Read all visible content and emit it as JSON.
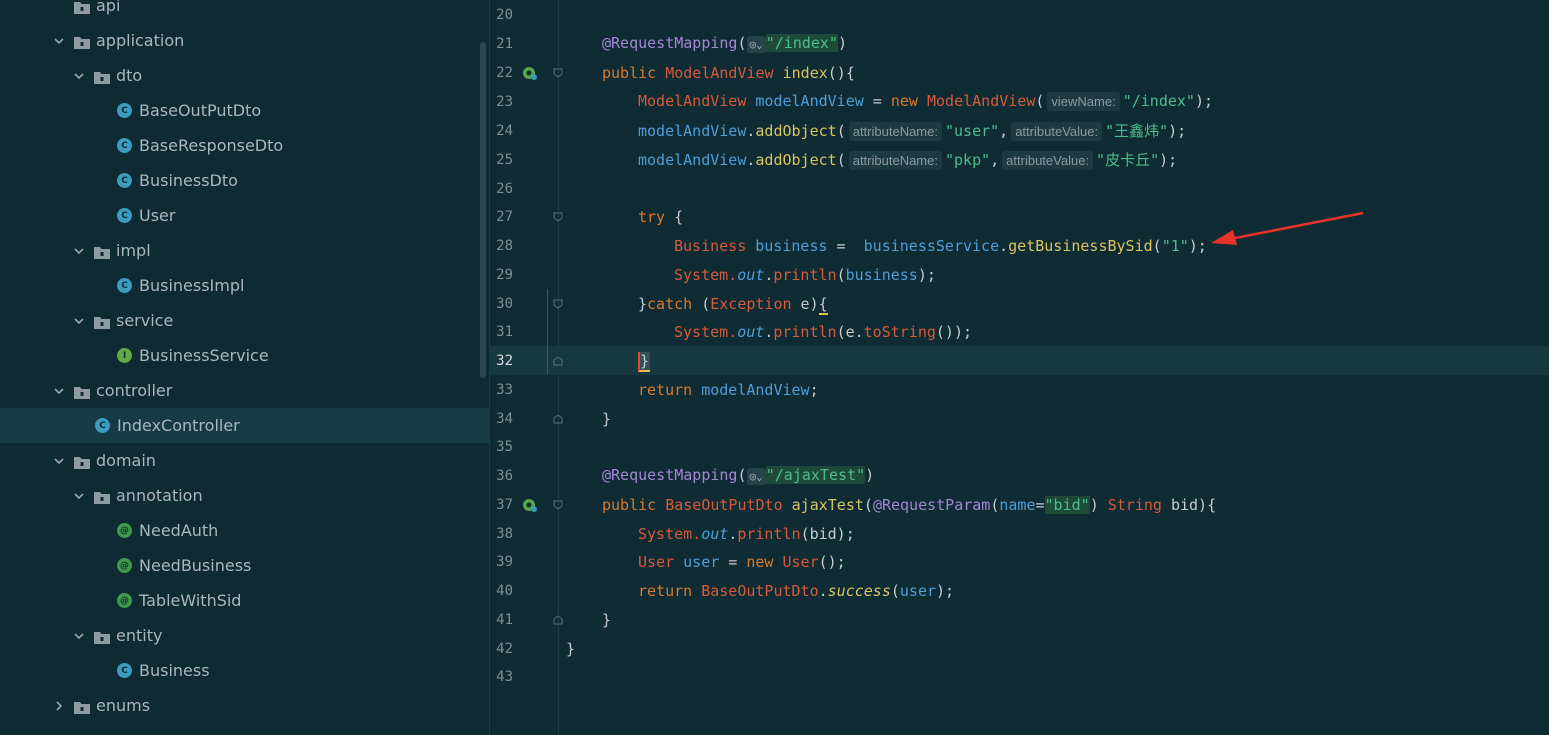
{
  "tree": {
    "items": [
      {
        "label": "api",
        "kind": "folder",
        "indent": 0,
        "expanded": false,
        "chevron": "none"
      },
      {
        "label": "application",
        "kind": "folder",
        "indent": 0,
        "expanded": true,
        "chevron": "down"
      },
      {
        "label": "dto",
        "kind": "folder",
        "indent": 1,
        "expanded": true,
        "chevron": "down"
      },
      {
        "label": "BaseOutPutDto",
        "kind": "class",
        "indent": 2
      },
      {
        "label": "BaseResponseDto",
        "kind": "class",
        "indent": 2
      },
      {
        "label": "BusinessDto",
        "kind": "class",
        "indent": 2
      },
      {
        "label": "User",
        "kind": "class",
        "indent": 2
      },
      {
        "label": "impl",
        "kind": "folder",
        "indent": 1,
        "expanded": true,
        "chevron": "down"
      },
      {
        "label": "BusinessImpl",
        "kind": "class",
        "indent": 2
      },
      {
        "label": "service",
        "kind": "folder",
        "indent": 1,
        "expanded": true,
        "chevron": "down"
      },
      {
        "label": "BusinessService",
        "kind": "interface",
        "indent": 2
      },
      {
        "label": "controller",
        "kind": "folder",
        "indent": 0,
        "expanded": true,
        "chevron": "down"
      },
      {
        "label": "IndexController",
        "kind": "class",
        "indent": 1,
        "selected": true
      },
      {
        "label": "domain",
        "kind": "folder",
        "indent": 0,
        "expanded": true,
        "chevron": "down"
      },
      {
        "label": "annotation",
        "kind": "folder",
        "indent": 1,
        "expanded": true,
        "chevron": "down"
      },
      {
        "label": "NeedAuth",
        "kind": "annotation",
        "indent": 2
      },
      {
        "label": "NeedBusiness",
        "kind": "annotation",
        "indent": 2
      },
      {
        "label": "TableWithSid",
        "kind": "annotation",
        "indent": 2
      },
      {
        "label": "entity",
        "kind": "folder",
        "indent": 1,
        "expanded": true,
        "chevron": "down"
      },
      {
        "label": "Business",
        "kind": "class",
        "indent": 2
      },
      {
        "label": "enums",
        "kind": "folder",
        "indent": 0,
        "expanded": false,
        "chevron": "right"
      }
    ]
  },
  "editor": {
    "current_line": "32",
    "line_numbers": [
      "20",
      "21",
      "22",
      "23",
      "24",
      "25",
      "26",
      "27",
      "28",
      "29",
      "30",
      "31",
      "32",
      "33",
      "34",
      "35",
      "36",
      "37",
      "38",
      "39",
      "40",
      "41",
      "42",
      "43"
    ],
    "code": {
      "l21_ann": "@RequestMapping",
      "l21_url": "\"/index\"",
      "l22_kw": "public",
      "l22_type": "ModelAndView",
      "l22_fn": "index",
      "l22_rest": "(){",
      "l23_type": "ModelAndView",
      "l23_var": "modelAndView",
      "l23_eq": " = ",
      "l23_new": "new",
      "l23_ctor": "ModelAndView",
      "l23_hint": "viewName:",
      "l23_str": "\"/index\"",
      "l23_end": ");",
      "l24_var": "modelAndView",
      "l24_fn": "addObject",
      "l24_hint1": "attributeName:",
      "l24_str1": "\"user\"",
      "l24_hint2": "attributeValue:",
      "l24_str2": "\"王鑫炜\"",
      "l24_end": ");",
      "l25_var": "modelAndView",
      "l25_fn": "addObject",
      "l25_hint1": "attributeName:",
      "l25_str1": "\"pkp\"",
      "l25_hint2": "attributeValue:",
      "l25_str2": "\"皮卡丘\"",
      "l25_end": ");",
      "l27_kw": "try",
      "l27_rest": " {",
      "l28_type": "Business",
      "l28_var": "business",
      "l28_eq": " =  ",
      "l28_svc": "businessService",
      "l28_fn": "getBusinessBySid",
      "l28_str": "\"1\"",
      "l28_end": ");",
      "l29_sys": "System.",
      "l29_out": "out",
      "l29_fn": "println",
      "l29_var": "business",
      "l29_end": ");",
      "l30_a": "}",
      "l30_kw": "catch",
      "l30_type": "Exception",
      "l30_rest": " e)",
      "l30_brace": "{",
      "l31_sys": "System.",
      "l31_out": "out",
      "l31_fn": "println",
      "l31_arg": "e.",
      "l31_fn2": "toString",
      "l31_end": "());",
      "l32_brace": "}",
      "l33_kw": "return",
      "l33_var": "modelAndView",
      "l33_end": ";",
      "l34": "}",
      "l36_ann": "@RequestMapping",
      "l36_url": "\"/ajaxTest\"",
      "l37_kw": "public",
      "l37_type": "BaseOutPutDto",
      "l37_fn": "ajaxTest",
      "l37_ann": "@RequestParam",
      "l37_name": "name",
      "l37_str": "\"bid\"",
      "l37_type2": "String",
      "l37_rest": " bid){",
      "l38_sys": "System.",
      "l38_out": "out",
      "l38_fn": "println",
      "l38_rest": "(bid);",
      "l39_type": "User",
      "l39_var": "user",
      "l39_eq": " = ",
      "l39_new": "new",
      "l39_ctor": "User",
      "l39_end": "();",
      "l40_kw": "return",
      "l40_type": "BaseOutPutDto",
      "l40_fn": "success",
      "l40_var": "user",
      "l40_end": ");",
      "l41": "}",
      "l42": "}"
    }
  },
  "colors": {
    "tree_bg": "#0e2a32",
    "editor_bg": "#0f2b33",
    "selected_row": "#163b44",
    "arrow": "#e8332a"
  }
}
